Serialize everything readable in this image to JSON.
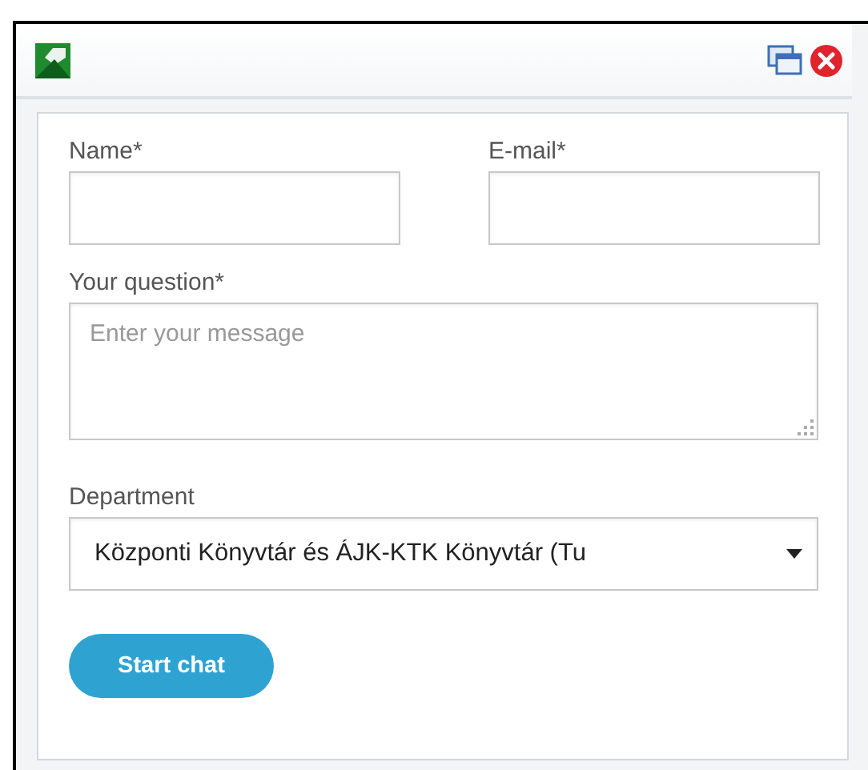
{
  "fields": [
    {
      "kind": "text",
      "label": "Name*"
    },
    {
      "kind": "text",
      "label": "E-mail*"
    },
    {
      "kind": "textarea",
      "label": "Your question*",
      "placeholder": "Enter your message"
    },
    {
      "kind": "select",
      "label": "Department",
      "value": "Központi Könyvtár és ÁJK-KTK Könyvtár (Tu"
    }
  ],
  "button": "Start chat"
}
